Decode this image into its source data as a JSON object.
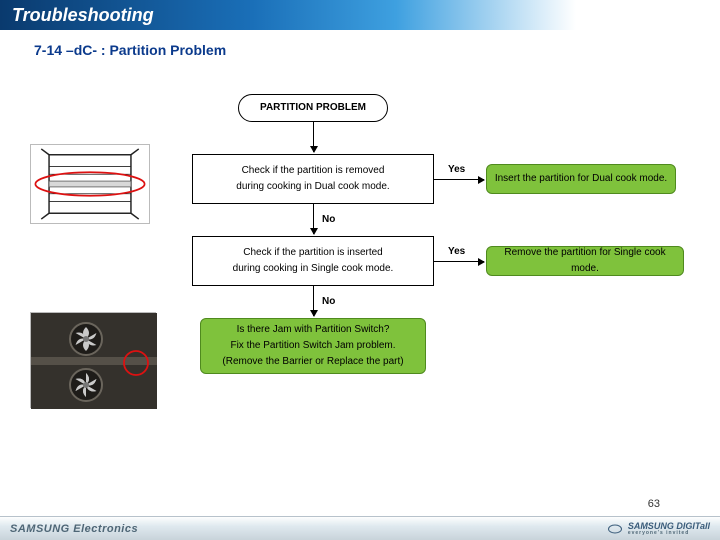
{
  "header": {
    "title": "Troubleshooting"
  },
  "subtitle": "7-14 –dC- : Partition Problem",
  "flow": {
    "start": "PARTITION PROBLEM",
    "check1_line1": "Check if the partition is removed",
    "check1_line2": "during cooking in Dual cook mode.",
    "action1": "Insert the partition for Dual cook mode.",
    "check2_line1": "Check if the partition is inserted",
    "check2_line2": "during cooking in Single cook mode.",
    "action2": "Remove the partition for Single cook mode.",
    "final_line1": "Is there Jam with Partition Switch?",
    "final_line2": "Fix the Partition Switch Jam problem.",
    "final_line3": "(Remove the Barrier or Replace the part)",
    "yes": "Yes",
    "no": "No"
  },
  "page": "63",
  "footer": {
    "brand": "SAMSUNG Electronics",
    "right": "SAMSUNG DIGITall",
    "tag": "everyone's invited"
  }
}
